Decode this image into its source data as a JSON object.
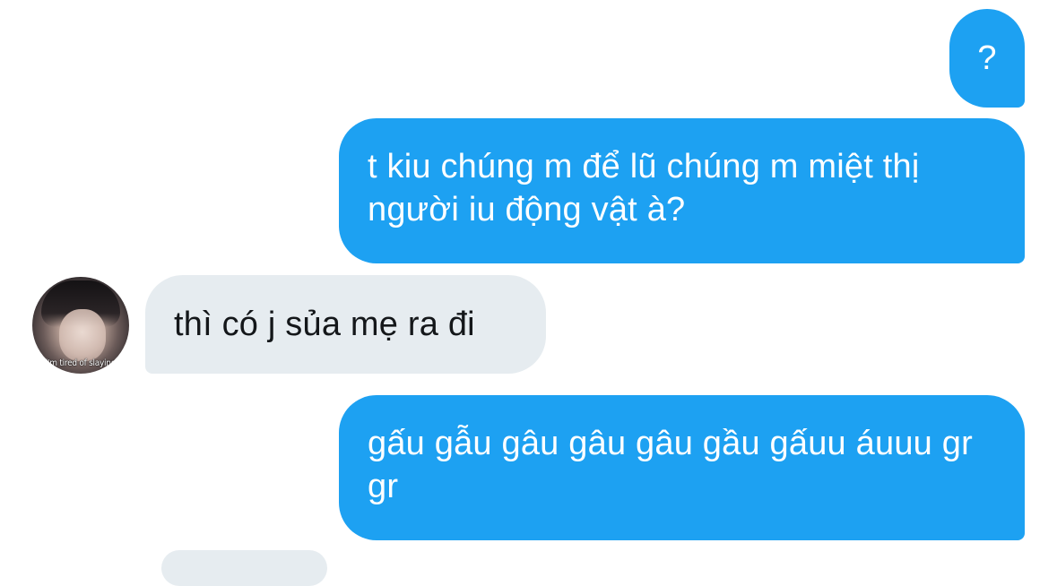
{
  "colors": {
    "outgoing_bubble": "#1da1f2",
    "incoming_bubble": "#e6ecf0",
    "outgoing_text": "#ffffff",
    "incoming_text": "#14171a",
    "background": "#ffffff"
  },
  "avatar": {
    "caption": "i'm tired of slaying"
  },
  "messages": [
    {
      "direction": "outgoing",
      "text": "?"
    },
    {
      "direction": "outgoing",
      "text": "t kiu chúng m để lũ chúng m miệt thị người iu động vật à?"
    },
    {
      "direction": "incoming",
      "text": "thì có j sủa mẹ ra đi"
    },
    {
      "direction": "outgoing",
      "text": "gấu gẫu gâu gâu gâu gầu gấuu áuuu gr gr"
    }
  ]
}
